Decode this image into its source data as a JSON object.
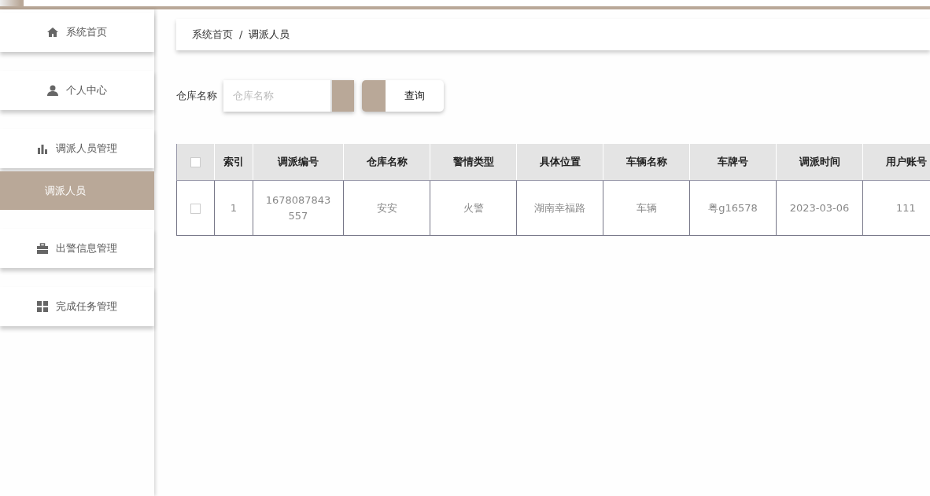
{
  "sidebar": {
    "items": [
      {
        "label": "系统首页",
        "selected": false
      },
      {
        "label": "个人中心",
        "selected": false
      },
      {
        "label": "调派人员管理",
        "selected": false,
        "children": [
          {
            "label": "调派人员",
            "selected": true
          }
        ]
      },
      {
        "label": "出警信息管理",
        "selected": false
      },
      {
        "label": "完成任务管理",
        "selected": false
      }
    ]
  },
  "breadcrumb": {
    "items": [
      "系统首页",
      "调派人员"
    ],
    "separator": "/"
  },
  "search": {
    "label": "仓库名称",
    "placeholder": "仓库名称",
    "button": "查询"
  },
  "table": {
    "select_all_checked": false,
    "columns": [
      "索引",
      "调派编号",
      "仓库名称",
      "警情类型",
      "具体位置",
      "车辆名称",
      "车牌号",
      "调派时间",
      "用户账号"
    ],
    "rows": [
      {
        "checked": false,
        "cells": [
          "1",
          "1678087843557",
          "安安",
          "火警",
          "湖南幸福路",
          "车辆",
          "粤g16578",
          "2023-03-06",
          "111"
        ]
      }
    ]
  }
}
